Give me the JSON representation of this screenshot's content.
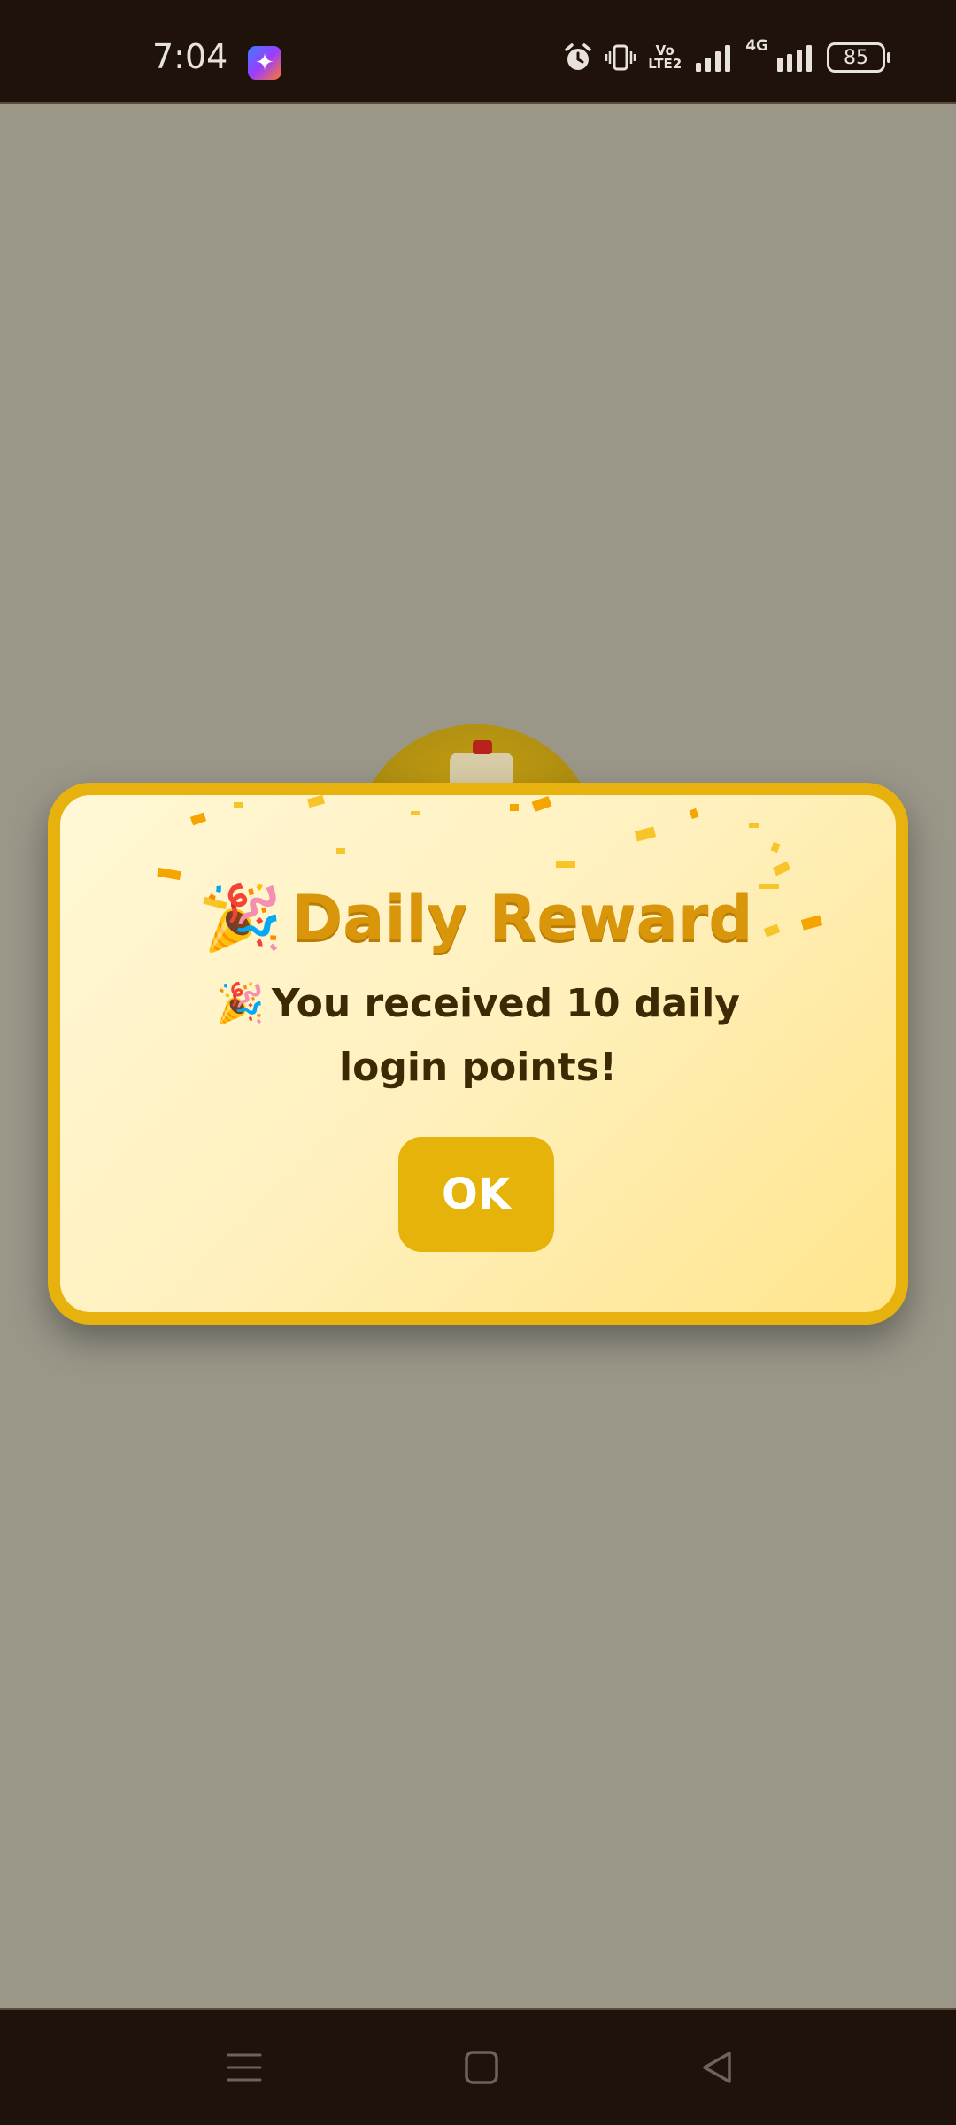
{
  "status_bar": {
    "time": "7:04",
    "app_icon": "star-app-icon",
    "icons": [
      "alarm-icon",
      "vibrate-icon",
      "volte-icon",
      "signal-icon",
      "signal-4g-icon",
      "battery-icon"
    ],
    "volte_label_top": "Vo",
    "volte_label_bottom": "LTE2",
    "network_label": "4G",
    "battery_level": "85"
  },
  "dialog": {
    "title_emoji": "🎉",
    "title": "Daily Reward",
    "message_emoji": "🎉",
    "message": "You received 10 daily login points!",
    "ok_label": "OK",
    "colors": {
      "border": "#e7b20e",
      "title": "#d9960a",
      "message": "#3d2a05",
      "button": "#e6b30b"
    }
  },
  "nav_bar": {
    "buttons": [
      "menu-icon",
      "home-icon",
      "back-icon"
    ]
  }
}
